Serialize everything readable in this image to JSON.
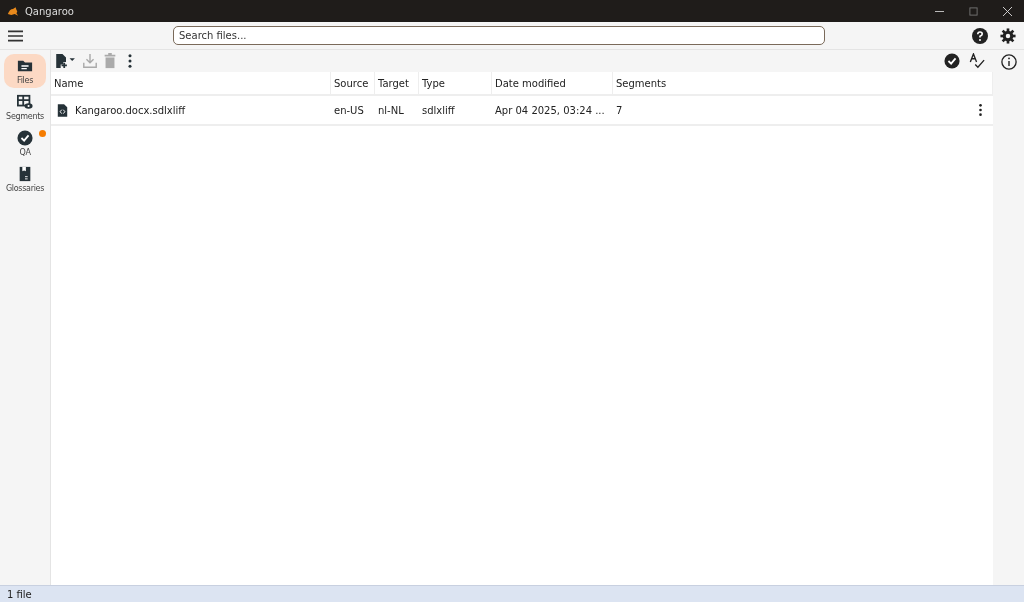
{
  "window": {
    "title": "Qangaroo"
  },
  "search": {
    "placeholder": "Search files..."
  },
  "nav": [
    {
      "label": "Files",
      "kind": "files",
      "selected": true,
      "alert": false
    },
    {
      "label": "Segments",
      "kind": "segments",
      "selected": false,
      "alert": false
    },
    {
      "label": "QA",
      "kind": "qa",
      "selected": false,
      "alert": true
    },
    {
      "label": "Glossaries",
      "kind": "glossaries",
      "selected": false,
      "alert": false
    }
  ],
  "toolbar": [
    {
      "kind": "add",
      "disabled": false
    },
    {
      "kind": "download",
      "disabled": true
    },
    {
      "kind": "delete",
      "disabled": true
    },
    {
      "kind": "more",
      "disabled": false
    }
  ],
  "table": {
    "columns": [
      "Name",
      "Source",
      "Target",
      "Type",
      "Date modified",
      "Segments"
    ],
    "rows": [
      {
        "cells": [
          "Kangaroo.docx.sdlxliff",
          "en-US",
          "nl-NL",
          "sdlxliff",
          "Apr 04 2025, 03:24 ...",
          "7"
        ],
        "selected": false
      }
    ]
  },
  "status_bar": "1 file"
}
